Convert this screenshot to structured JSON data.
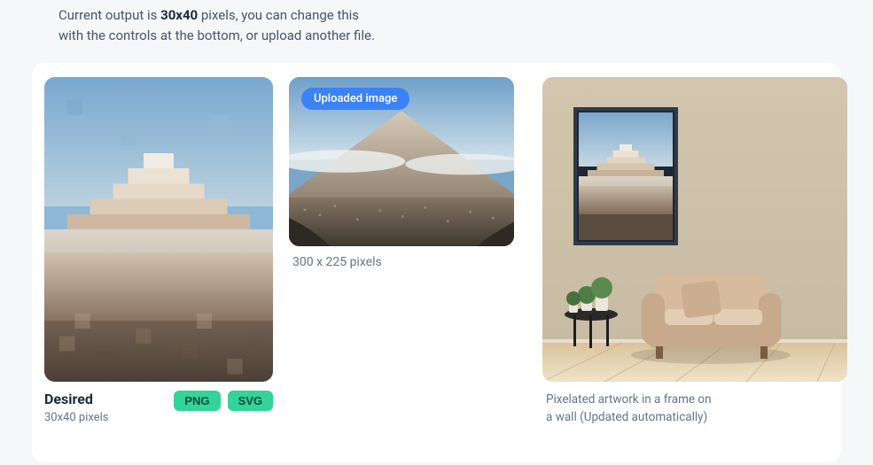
{
  "intro": {
    "prefix": "Current output is ",
    "dims": "30x40",
    "suffix1": " pixels, you can change this",
    "suffix2": "with the controls at the bottom, or upload another file."
  },
  "desired": {
    "title": "Desired",
    "sub": "30x40 pixels",
    "png_label": "PNG",
    "svg_label": "SVG"
  },
  "upload": {
    "badge": "Uploaded image",
    "sub": "300 x 225 pixels"
  },
  "wall": {
    "sub1": "Pixelated artwork in a frame on",
    "sub2": "a wall (Updated automatically)"
  }
}
